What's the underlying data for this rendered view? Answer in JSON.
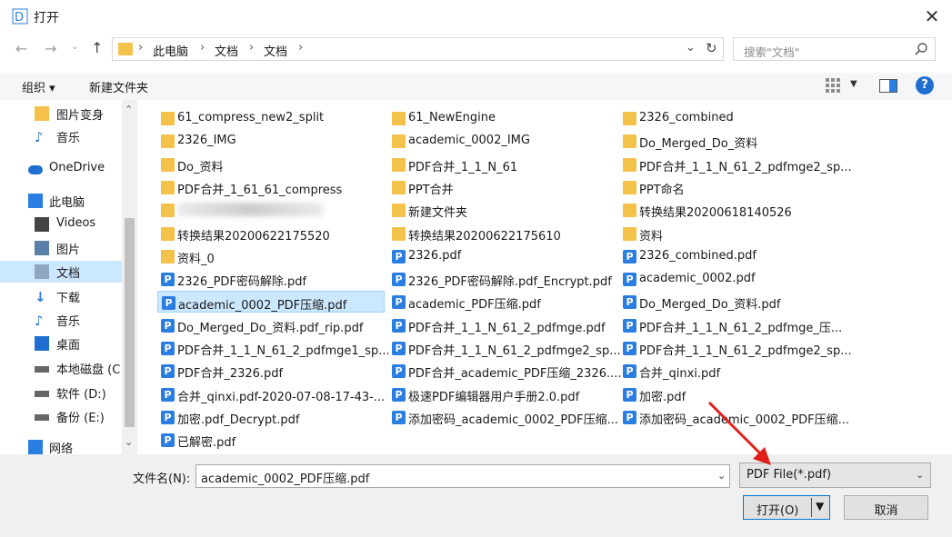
{
  "window": {
    "title": "打开",
    "app_icon_letter": "D"
  },
  "address": {
    "crumbs": [
      "此电脑",
      "文档",
      "文档"
    ]
  },
  "search": {
    "placeholder": "搜索\"文档\""
  },
  "toolbar": {
    "organize": "组织 ▾",
    "new_folder": "新建文件夹"
  },
  "nav": {
    "items": [
      {
        "label": "图片变身",
        "icon": "folder-icon"
      },
      {
        "label": "音乐",
        "icon": "music-icon"
      },
      {
        "label": "OneDrive",
        "icon": "cloud-icon"
      },
      {
        "label": "此电脑",
        "icon": "computer-icon"
      },
      {
        "label": "Videos",
        "icon": "video-icon"
      },
      {
        "label": "图片",
        "icon": "pictures-icon"
      },
      {
        "label": "文档",
        "icon": "documents-icon",
        "selected": true
      },
      {
        "label": "下载",
        "icon": "download-icon"
      },
      {
        "label": "音乐",
        "icon": "music-icon"
      },
      {
        "label": "桌面",
        "icon": "desktop-icon"
      },
      {
        "label": "本地磁盘 (C",
        "icon": "drive-icon"
      },
      {
        "label": "软件 (D:)",
        "icon": "drive-icon"
      },
      {
        "label": "备份 (E:)",
        "icon": "drive-icon"
      },
      {
        "label": "网络",
        "icon": "network-icon"
      }
    ]
  },
  "files": {
    "col1": [
      {
        "name": "61_compress_new2_split",
        "type": "folder"
      },
      {
        "name": "2326_IMG",
        "type": "folder"
      },
      {
        "name": "Do_资料",
        "type": "folder"
      },
      {
        "name": "PDF合并_1_61_61_compress",
        "type": "folder"
      },
      {
        "name": "转换结果20200622175520",
        "type": "folder"
      },
      {
        "name": "资料_0",
        "type": "folder"
      },
      {
        "name": "2326_PDF密码解除.pdf",
        "type": "pdf"
      },
      {
        "name": "academic_0002_PDF压缩.pdf",
        "type": "pdf",
        "selected": true
      },
      {
        "name": "Do_Merged_Do_资料.pdf_rip.pdf",
        "type": "pdf"
      },
      {
        "name": "PDF合并_1_1_N_61_2_pdfmge1_sp...",
        "type": "pdf"
      },
      {
        "name": "PDF合并_2326.pdf",
        "type": "pdf"
      },
      {
        "name": "合并_qinxi.pdf-2020-07-08-17-43-...",
        "type": "pdf"
      },
      {
        "name": "加密.pdf_Decrypt.pdf",
        "type": "pdf"
      },
      {
        "name": "已解密.pdf",
        "type": "pdf"
      }
    ],
    "col2": [
      {
        "name": "61_NewEngine",
        "type": "folder"
      },
      {
        "name": "academic_0002_IMG",
        "type": "folder"
      },
      {
        "name": "PDF合并_1_1_N_61",
        "type": "folder"
      },
      {
        "name": "PPT合并",
        "type": "folder"
      },
      {
        "name": "新建文件夹",
        "type": "folder"
      },
      {
        "name": "转换结果20200622175610",
        "type": "folder"
      },
      {
        "name": "2326.pdf",
        "type": "pdf"
      },
      {
        "name": "2326_PDF密码解除.pdf_Encrypt.pdf",
        "type": "pdf"
      },
      {
        "name": "academic_PDF压缩.pdf",
        "type": "pdf"
      },
      {
        "name": "PDF合并_1_1_N_61_2_pdfmge.pdf",
        "type": "pdf"
      },
      {
        "name": "PDF合并_1_1_N_61_2_pdfmge2_sp...",
        "type": "pdf"
      },
      {
        "name": "PDF合并_academic_PDF压缩_2326....",
        "type": "pdf"
      },
      {
        "name": "极速PDF编辑器用户手册2.0.pdf",
        "type": "pdf"
      },
      {
        "name": "添加密码_academic_0002_PDF压缩...",
        "type": "pdf"
      }
    ],
    "col3": [
      {
        "name": "2326_combined",
        "type": "folder"
      },
      {
        "name": "Do_Merged_Do_资料",
        "type": "folder"
      },
      {
        "name": "PDF合并_1_1_N_61_2_pdfmge2_sp...",
        "type": "folder"
      },
      {
        "name": "PPT命名",
        "type": "folder"
      },
      {
        "name": "转换结果20200618140526",
        "type": "folder"
      },
      {
        "name": "资料",
        "type": "folder"
      },
      {
        "name": "2326_combined.pdf",
        "type": "pdf"
      },
      {
        "name": "academic_0002.pdf",
        "type": "pdf"
      },
      {
        "name": "Do_Merged_Do_资料.pdf",
        "type": "pdf"
      },
      {
        "name": "PDF合并_1_1_N_61_2_pdfmge_压...",
        "type": "pdf"
      },
      {
        "name": "PDF合并_1_1_N_61_2_pdfmge2_sp...",
        "type": "pdf"
      },
      {
        "name": "合并_qinxi.pdf",
        "type": "pdf"
      },
      {
        "name": "加密.pdf",
        "type": "pdf"
      },
      {
        "name": "添加密码_academic_0002_PDF压缩...",
        "type": "pdf"
      }
    ],
    "blurred_item": {
      "name": "……",
      "type": "folder"
    }
  },
  "bottom": {
    "filename_label": "文件名(N):",
    "filename_value": "academic_0002_PDF压缩.pdf",
    "filetype_value": "PDF File(*.pdf)",
    "open_label": "打开(O)",
    "cancel_label": "取消"
  },
  "colors": {
    "selection": "#cce8ff",
    "folder": "#f4c24a",
    "pdf": "#2a7de1",
    "arrow": "#e0201b",
    "accent": "#0078d7"
  }
}
